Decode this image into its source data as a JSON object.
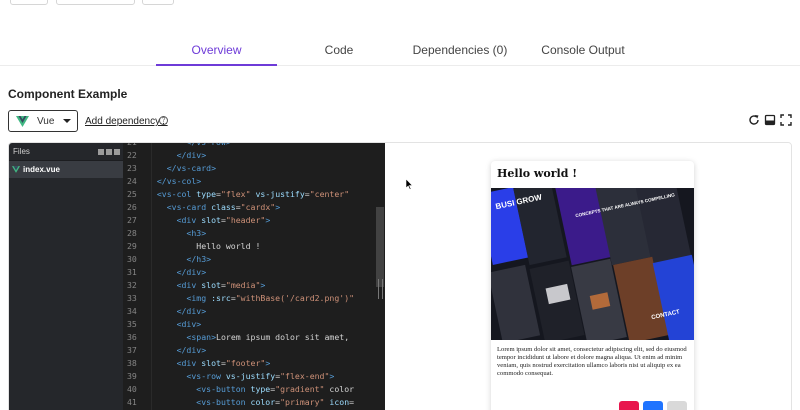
{
  "tabs": [
    {
      "label": "Overview",
      "active": true
    },
    {
      "label": "Code",
      "active": false
    },
    {
      "label": "Dependencies (0)",
      "active": false
    },
    {
      "label": "Console Output",
      "active": false
    }
  ],
  "section_title": "Component Example",
  "framework_select": {
    "value": "Vue"
  },
  "add_dependency_label": "Add dependency...",
  "help_glyph": "?",
  "toolbar_icons": [
    "refresh-icon",
    "layout-icon",
    "fullscreen-icon"
  ],
  "files_panel": {
    "title": "Files",
    "files": [
      {
        "name": "index.vue",
        "selected": true
      }
    ]
  },
  "editor": {
    "lines": [
      {
        "n": "21",
        "code": "        </vs-row>"
      },
      {
        "n": "22",
        "code": "      </div>"
      },
      {
        "n": "23",
        "code": "    </vs-card>"
      },
      {
        "n": "24",
        "code": "  </vs-col>"
      },
      {
        "n": "25",
        "code": "  <vs-col type=\"flex\" vs-justify=\"center\""
      },
      {
        "n": "26",
        "code": "    <vs-card class=\"cardx\">"
      },
      {
        "n": "27",
        "code": "      <div slot=\"header\">"
      },
      {
        "n": "28",
        "code": "        <h3>"
      },
      {
        "n": "29",
        "code": "          Hello world !"
      },
      {
        "n": "30",
        "code": "        </h3>"
      },
      {
        "n": "31",
        "code": "      </div>"
      },
      {
        "n": "32",
        "code": "      <div slot=\"media\">"
      },
      {
        "n": "33",
        "code": "        <img :src=\"withBase('/card2.png')\""
      },
      {
        "n": "34",
        "code": "      </div>"
      },
      {
        "n": "35",
        "code": "      <div>"
      },
      {
        "n": "36",
        "code": "        <span>Lorem ipsum dolor sit amet,"
      },
      {
        "n": "37",
        "code": "      </div>"
      },
      {
        "n": "38",
        "code": "      <div slot=\"footer\">"
      },
      {
        "n": "39",
        "code": "        <vs-row vs-justify=\"flex-end\">"
      },
      {
        "n": "40",
        "code": "          <vs-button type=\"gradient\" color"
      },
      {
        "n": "41",
        "code": "          <vs-button color=\"primary\" icon="
      }
    ]
  },
  "preview_card": {
    "title": "Hello world !",
    "media_texts": [
      "BUSI GROW",
      "CONCEPTS THAT ARE ALWAYS COMPELLING",
      "CONTACT"
    ],
    "body": "Lorem ipsum dolor sit amet, consectetur adipiscing elit, sed do eiusmod tempor incididunt ut labore et dolore magna aliqua. Ut enim ad minim veniam, quis nostrud exercitation ullamco laboris nisi ut aliquip ex ea commodo consequat.",
    "footer_buttons": [
      {
        "name": "gradient-button",
        "color": "#e8164d"
      },
      {
        "name": "primary-button",
        "color": "#1f74ff"
      },
      {
        "name": "disabled-button",
        "color": "#d9d9d9"
      }
    ]
  },
  "colors": {
    "accent": "#6e3bd8",
    "editor_bg": "#1e1e1e",
    "files_bg": "#25272b"
  }
}
